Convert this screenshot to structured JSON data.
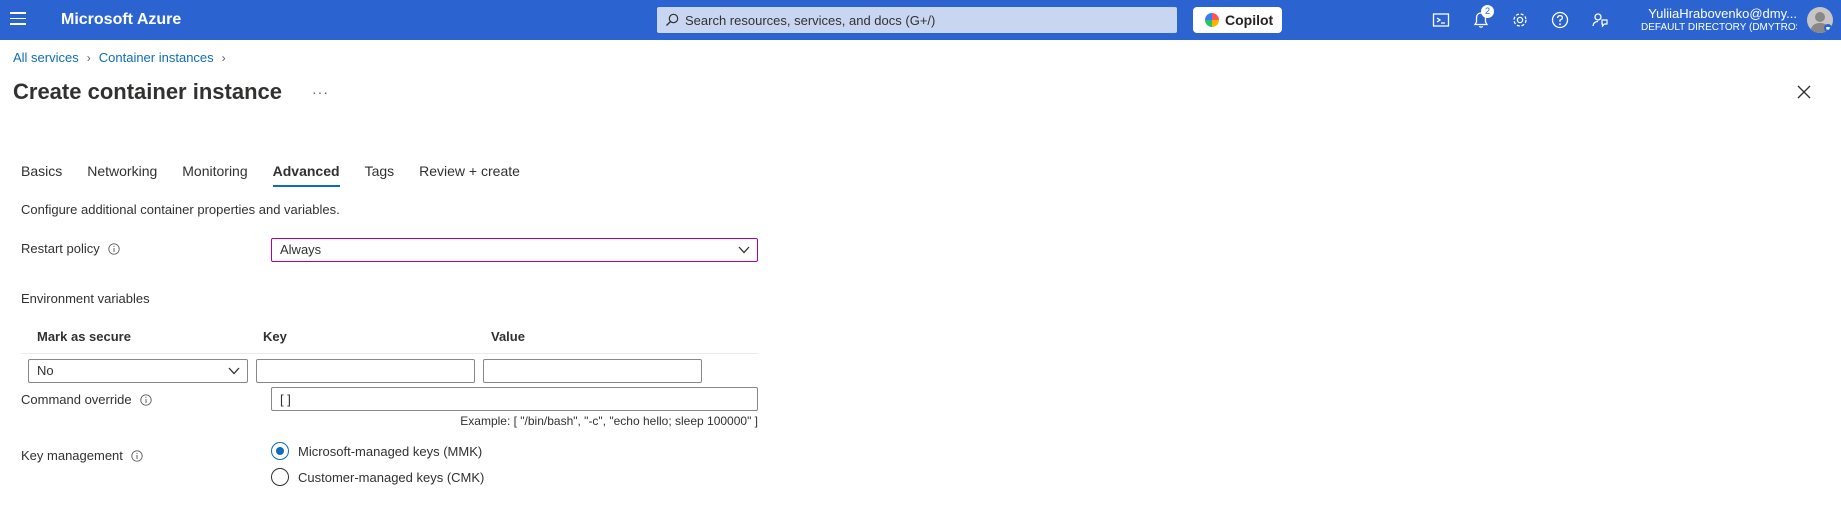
{
  "topbar": {
    "brand": "Microsoft Azure",
    "search_placeholder": "Search resources, services, and docs (G+/)",
    "copilot_label": "Copilot",
    "notification_count": "2",
    "user_name": "YuliiaHrabovenko@dmy...",
    "user_directory": "DEFAULT DIRECTORY (DMYTROS...",
    "icons": [
      "hamburger-icon",
      "search-icon",
      "copilot-icon",
      "cloud-shell-icon",
      "bell-icon",
      "gear-icon",
      "help-icon",
      "feedback-icon"
    ]
  },
  "breadcrumb": {
    "items": [
      "All services",
      "Container instances"
    ]
  },
  "page": {
    "title": "Create container instance",
    "more": "···"
  },
  "tabs": [
    "Basics",
    "Networking",
    "Monitoring",
    "Advanced",
    "Tags",
    "Review + create"
  ],
  "active_tab": "Advanced",
  "form": {
    "description": "Configure additional container properties and variables.",
    "restart_policy": {
      "label": "Restart policy",
      "value": "Always"
    },
    "env_vars": {
      "title": "Environment variables",
      "headers": [
        "Mark as secure",
        "Key",
        "Value"
      ],
      "row": {
        "secure": "No",
        "key": "",
        "value": ""
      }
    },
    "command_override": {
      "label": "Command override",
      "value": "[ ]",
      "example": "Example: [ \"/bin/bash\", \"-c\", \"echo hello; sleep 100000\" ]"
    },
    "key_management": {
      "label": "Key management",
      "options": [
        "Microsoft-managed keys (MMK)",
        "Customer-managed keys (CMK)"
      ],
      "selected": "Microsoft-managed keys (MMK)"
    }
  },
  "colors": {
    "topbar": "#2b64d1",
    "accent": "#0f6cbd",
    "focus_border": "#b4009e"
  }
}
